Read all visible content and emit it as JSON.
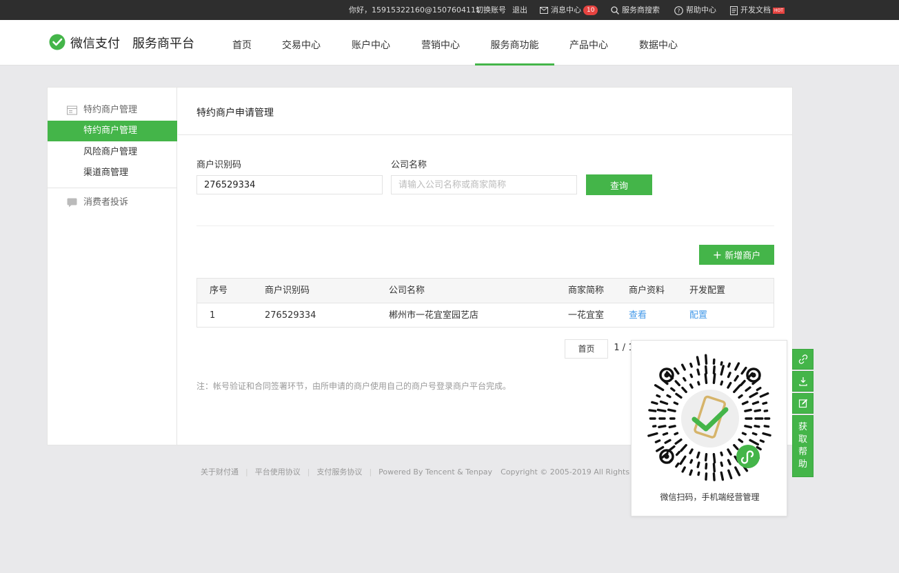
{
  "topbar": {
    "greeting": "你好，15915322160@1507604111",
    "switch_account": "切换账号",
    "logout": "退出",
    "messages": "消息中心",
    "message_count": "10",
    "provider_search": "服务商搜索",
    "help_center": "帮助中心",
    "dev_docs": "开发文档",
    "hot_badge": "HOT"
  },
  "header": {
    "brand": "微信支付",
    "platform": "服务商平台",
    "nav": [
      {
        "label": "首页"
      },
      {
        "label": "交易中心"
      },
      {
        "label": "账户中心"
      },
      {
        "label": "营销中心"
      },
      {
        "label": "服务商功能"
      },
      {
        "label": "产品中心"
      },
      {
        "label": "数据中心"
      }
    ],
    "active_nav": "服务商功能",
    "accent_color": "#44b549"
  },
  "sidebar": {
    "group1": "特约商户管理",
    "items": [
      {
        "label": "特约商户管理"
      },
      {
        "label": "风险商户管理"
      },
      {
        "label": "渠道商管理"
      }
    ],
    "group2": "消费者投诉"
  },
  "main": {
    "title": "特约商户申请管理",
    "form": {
      "merchant_id_label": "商户识别码",
      "merchant_id_value": "276529334",
      "company_label": "公司名称",
      "company_placeholder": "请输入公司名称或商家简称",
      "query_button": "查询"
    },
    "add_button": "新增商户",
    "table": {
      "headers": [
        "序号",
        "商户识别码",
        "公司名称",
        "商家简称",
        "商户资料",
        "开发配置"
      ],
      "rows": [
        {
          "index": "1",
          "merchant_id": "276529334",
          "company": "郴州市一花宜室园艺店",
          "short_name": "一花宜室",
          "info_link": "查看",
          "config_link": "配置"
        }
      ]
    },
    "pagination": {
      "first": "首页",
      "page_info": "1 / 1"
    },
    "note": "注：帐号验证和合同签署环节，由所申请的商户使用自己的商户号登录商户平台完成。"
  },
  "footer": {
    "links": [
      "关于财付通",
      "平台使用协议",
      "支付服务协议"
    ],
    "powered": "Powered By Tencent & Tenpay",
    "copyright": "Copyright © 2005-2019 All Rights Reserve"
  },
  "qr_popup": {
    "caption": "微信扫码，手机端经营管理"
  },
  "side_tools": {
    "help_label": "获取帮助"
  }
}
